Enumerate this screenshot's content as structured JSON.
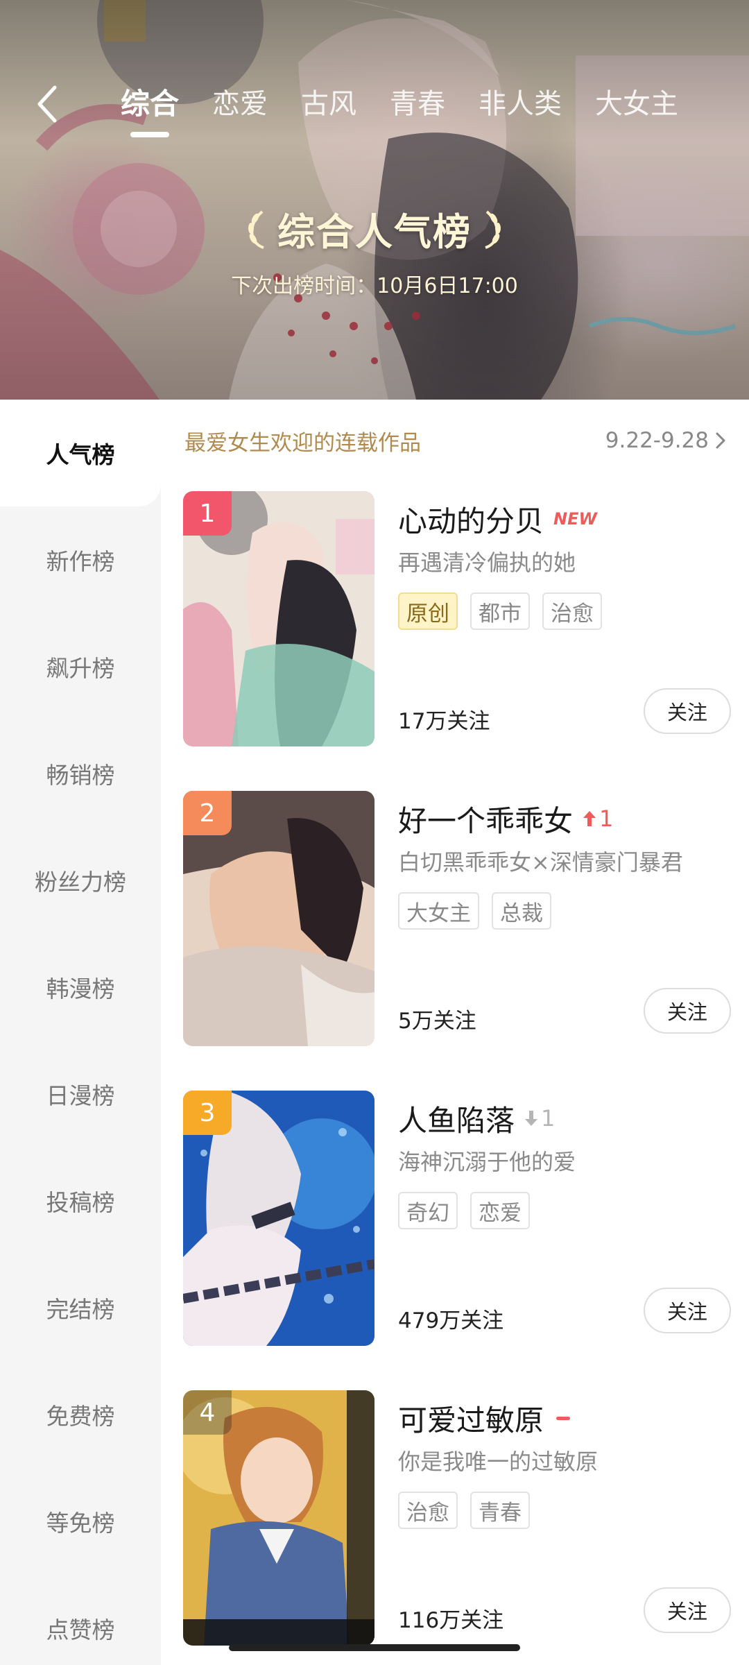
{
  "top_tabs": [
    "综合",
    "恋爱",
    "古风",
    "青春",
    "非人类",
    "大女主"
  ],
  "active_tab_index": 0,
  "banner": {
    "title": "综合人气榜",
    "subtitle": "下次出榜时间：10月6日17:00"
  },
  "sidebar": [
    "人气榜",
    "新作榜",
    "飙升榜",
    "畅销榜",
    "粉丝力榜",
    "韩漫榜",
    "日漫榜",
    "投稿榜",
    "完结榜",
    "免费榜",
    "等免榜",
    "点赞榜"
  ],
  "sidebar_active_index": 0,
  "list_header": {
    "caption": "最爱女生欢迎的连载作品",
    "range": "9.22-9.28"
  },
  "items": [
    {
      "rank": "1",
      "rank_color": "#f2566a",
      "title": "心动的分贝",
      "badge": "NEW",
      "description": "再遇清冷偏执的她",
      "tags": [
        "原创",
        "都市",
        "治愈"
      ],
      "follows": "17万关注",
      "follow_label": "关注"
    },
    {
      "rank": "2",
      "rank_color": "#f58a5a",
      "title": "好一个乖乖女",
      "trend": "up",
      "trend_value": "1",
      "description": "白切黑乖乖女×深情豪门暴君",
      "tags": [
        "大女主",
        "总裁"
      ],
      "follows": "5万关注",
      "follow_label": "关注"
    },
    {
      "rank": "3",
      "rank_color": "#f7a928",
      "title": "人鱼陷落",
      "trend": "down",
      "trend_value": "1",
      "description": "海神沉溺于他的爱",
      "tags": [
        "奇幻",
        "恋爱"
      ],
      "follows": "479万关注",
      "follow_label": "关注"
    },
    {
      "rank": "4",
      "rank_color": "rgba(40,40,40,0.35)",
      "title": "可爱过敏原",
      "trend": "flat",
      "description": "你是我唯一的过敏原",
      "tags": [
        "治愈",
        "青春"
      ],
      "follows": "116万关注",
      "follow_label": "关注"
    }
  ],
  "colors": {
    "accent": "#ef5a5a",
    "caption_gold": "#b08a4e",
    "hot_tag_bg": "#fff4c8"
  }
}
